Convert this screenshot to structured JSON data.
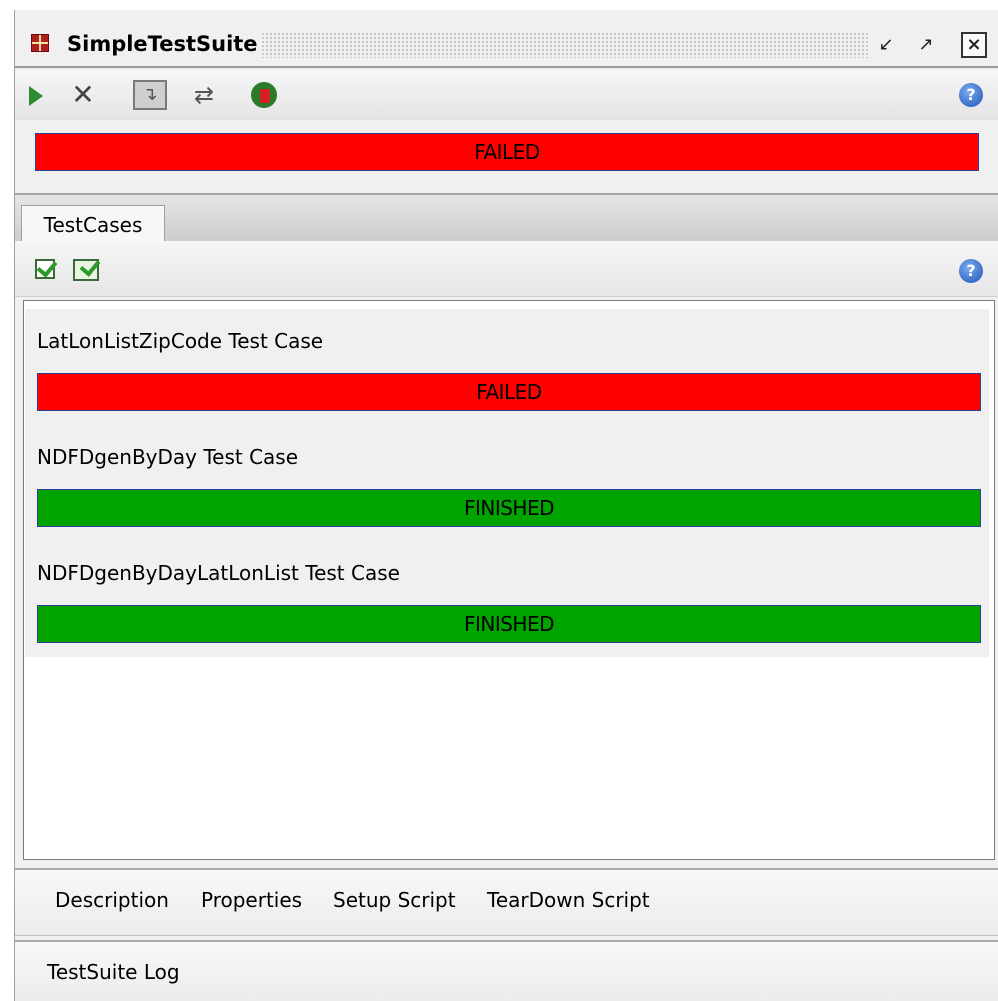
{
  "window": {
    "title": "SimpleTestSuite"
  },
  "toolbar": {
    "run": "run-icon",
    "cancel": "cancel-icon",
    "sequential": "sequential-icon",
    "parallel": "parallel-icon",
    "loadtest": "loadtest-icon",
    "help": "?"
  },
  "suite": {
    "status": "FAILED"
  },
  "tabs": [
    {
      "label": "TestCases"
    }
  ],
  "subtoolbar": {
    "help": "?"
  },
  "test_cases": [
    {
      "name": "LatLonListZipCode Test Case",
      "status": "FAILED"
    },
    {
      "name": "NDFDgenByDay Test Case",
      "status": "FINISHED"
    },
    {
      "name": "NDFDgenByDayLatLonList Test Case",
      "status": "FINISHED"
    }
  ],
  "bottom_tabs": [
    "Description",
    "Properties",
    "Setup Script",
    "TearDown Script"
  ],
  "log": {
    "label": "TestSuite Log"
  },
  "colors": {
    "failed": "#ff0000",
    "finished": "#00a300"
  }
}
